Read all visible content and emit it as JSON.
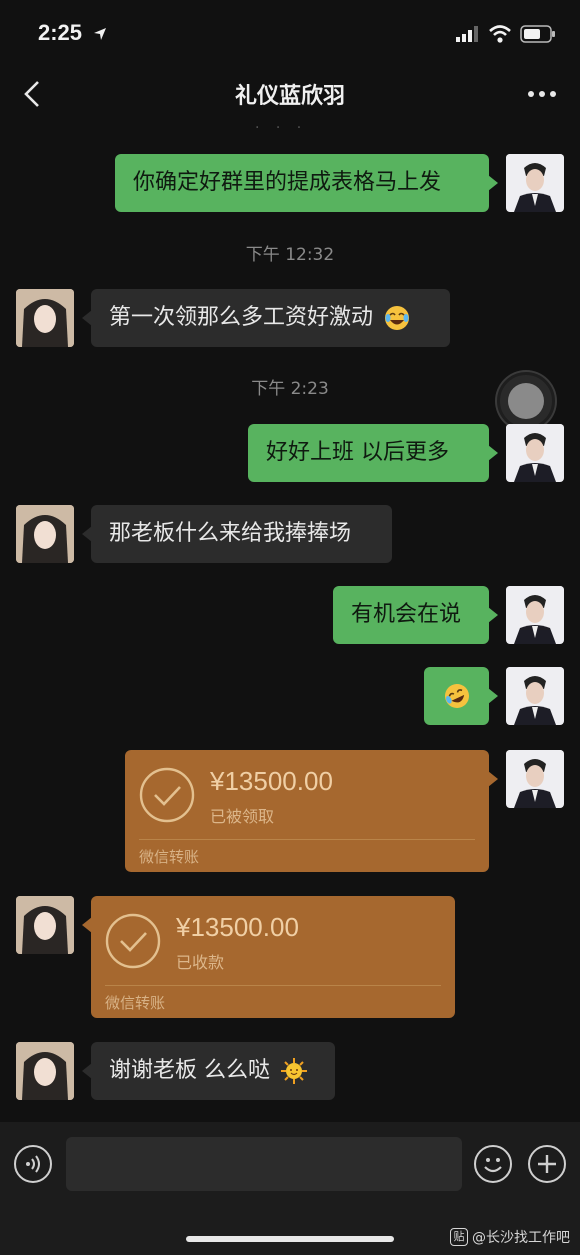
{
  "status_bar": {
    "time": "2:25"
  },
  "nav": {
    "title": "礼仪蓝欣羽"
  },
  "messages": {
    "m1": "你确定好群里的提成表格马上发",
    "ts1": "下午 12:32",
    "m2": "第一次领那么多工资好激动",
    "ts2": "下午 2:23",
    "m3": "好好上班 以后更多",
    "m4": "那老板什么来给我捧捧场",
    "m5": "有机会在说",
    "m7": "谢谢老板 么么哒"
  },
  "transfer_sent": {
    "amount": "¥13500.00",
    "status": "已被领取",
    "label": "微信转账"
  },
  "transfer_received": {
    "amount": "¥13500.00",
    "status": "已收款",
    "label": "微信转账"
  },
  "input_bar": {
    "placeholder": ""
  },
  "watermark": {
    "badge": "贴",
    "text": "@长沙找工作吧"
  },
  "icons": {
    "emoji_laugh": "face-with-tears-of-joy-icon",
    "emoji_sun": "sun-with-face-icon",
    "emoji_cry_laugh": "rolling-laughing-icon"
  },
  "colors": {
    "self_bubble": "#58b35f",
    "other_bubble": "#2c2c2c",
    "transfer": "#a6682f",
    "background": "#111111"
  }
}
